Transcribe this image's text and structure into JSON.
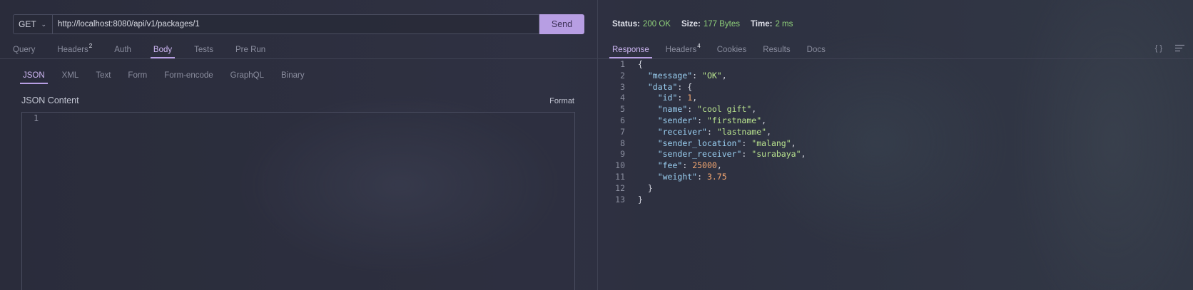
{
  "request": {
    "method": "GET",
    "url": "http://localhost:8080/api/v1/packages/1",
    "send_label": "Send",
    "tabs": [
      {
        "label": "Query",
        "badge": ""
      },
      {
        "label": "Headers",
        "badge": "2"
      },
      {
        "label": "Auth",
        "badge": ""
      },
      {
        "label": "Body",
        "badge": "",
        "active": true
      },
      {
        "label": "Tests",
        "badge": ""
      },
      {
        "label": "Pre Run",
        "badge": ""
      }
    ],
    "body_tabs": [
      "JSON",
      "XML",
      "Text",
      "Form",
      "Form-encode",
      "GraphQL",
      "Binary"
    ],
    "body_active": "JSON",
    "content_label": "JSON Content",
    "format_label": "Format",
    "editor_line": "1"
  },
  "response": {
    "status_label": "Status:",
    "status_value": "200 OK",
    "size_label": "Size:",
    "size_value": "177 Bytes",
    "time_label": "Time:",
    "time_value": "2 ms",
    "tabs": [
      {
        "label": "Response",
        "badge": "",
        "active": true
      },
      {
        "label": "Headers",
        "badge": "4"
      },
      {
        "label": "Cookies",
        "badge": ""
      },
      {
        "label": "Results",
        "badge": ""
      },
      {
        "label": "Docs",
        "badge": ""
      }
    ],
    "icons": [
      "braces-icon",
      "wrap-lines-icon"
    ],
    "braces_glyph": "{ }",
    "code": [
      {
        "n": "1",
        "t": [
          [
            "pun",
            "{"
          ]
        ]
      },
      {
        "n": "2",
        "t": [
          [
            "pun",
            "  "
          ],
          [
            "key",
            "\"message\""
          ],
          [
            "pun",
            ": "
          ],
          [
            "str",
            "\"OK\""
          ],
          [
            "pun",
            ","
          ]
        ]
      },
      {
        "n": "3",
        "t": [
          [
            "pun",
            "  "
          ],
          [
            "key",
            "\"data\""
          ],
          [
            "pun",
            ": {"
          ]
        ]
      },
      {
        "n": "4",
        "t": [
          [
            "pun",
            "    "
          ],
          [
            "key",
            "\"id\""
          ],
          [
            "pun",
            ": "
          ],
          [
            "num",
            "1"
          ],
          [
            "pun",
            ","
          ]
        ]
      },
      {
        "n": "5",
        "t": [
          [
            "pun",
            "    "
          ],
          [
            "key",
            "\"name\""
          ],
          [
            "pun",
            ": "
          ],
          [
            "str",
            "\"cool gift\""
          ],
          [
            "pun",
            ","
          ]
        ]
      },
      {
        "n": "6",
        "t": [
          [
            "pun",
            "    "
          ],
          [
            "key",
            "\"sender\""
          ],
          [
            "pun",
            ": "
          ],
          [
            "str",
            "\"firstname\""
          ],
          [
            "pun",
            ","
          ]
        ]
      },
      {
        "n": "7",
        "t": [
          [
            "pun",
            "    "
          ],
          [
            "key",
            "\"receiver\""
          ],
          [
            "pun",
            ": "
          ],
          [
            "str",
            "\"lastname\""
          ],
          [
            "pun",
            ","
          ]
        ]
      },
      {
        "n": "8",
        "t": [
          [
            "pun",
            "    "
          ],
          [
            "key",
            "\"sender_location\""
          ],
          [
            "pun",
            ": "
          ],
          [
            "str",
            "\"malang\""
          ],
          [
            "pun",
            ","
          ]
        ]
      },
      {
        "n": "9",
        "t": [
          [
            "pun",
            "    "
          ],
          [
            "key",
            "\"sender_receiver\""
          ],
          [
            "pun",
            ": "
          ],
          [
            "str",
            "\"surabaya\""
          ],
          [
            "pun",
            ","
          ]
        ]
      },
      {
        "n": "10",
        "t": [
          [
            "pun",
            "    "
          ],
          [
            "key",
            "\"fee\""
          ],
          [
            "pun",
            ": "
          ],
          [
            "num",
            "25000"
          ],
          [
            "pun",
            ","
          ]
        ]
      },
      {
        "n": "11",
        "t": [
          [
            "pun",
            "    "
          ],
          [
            "key",
            "\"weight\""
          ],
          [
            "pun",
            ": "
          ],
          [
            "num",
            "3.75"
          ]
        ]
      },
      {
        "n": "12",
        "t": [
          [
            "pun",
            "  }"
          ]
        ]
      },
      {
        "n": "13",
        "t": [
          [
            "pun",
            "}"
          ]
        ]
      }
    ]
  },
  "colors": {
    "accent": "#b79ee3",
    "status_ok": "#8fd07a",
    "json_key": "#9bd0f2",
    "json_string": "#b8e28e",
    "json_number": "#f4a771"
  }
}
